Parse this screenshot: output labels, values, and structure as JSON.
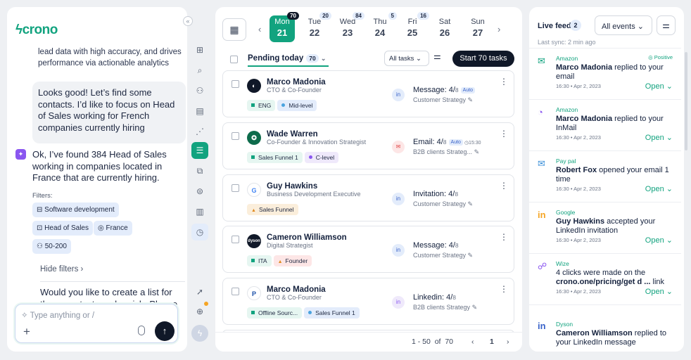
{
  "brand": "crono",
  "chat": {
    "prev_text": "lead data with high accuracy, and drives performance via actionable analytics",
    "user_msg": "Looks good! Let’s find some contacts. I’d like to focus on Head of Sales working for French companies currently hiring",
    "ai_msg": "Ok, I’ve found 384 Head of Sales working in companies located in France that are currently hiring.",
    "filters_label": "Filters:",
    "chips": [
      "Software development",
      "Head of Sales",
      "France",
      "50-200"
    ],
    "hide_filters": "Hide filters",
    "followup": "Would you like to create a list for these contacts and enrich. Please ad",
    "input_placeholder": "Type anything or /"
  },
  "calendar": {
    "days": [
      {
        "name": "Mon",
        "date": "21",
        "count": "70",
        "selected": true
      },
      {
        "name": "Tue",
        "date": "22",
        "count": "20"
      },
      {
        "name": "Wed",
        "date": "23",
        "count": "84"
      },
      {
        "name": "Thu",
        "date": "24",
        "count": "5"
      },
      {
        "name": "Fri",
        "date": "25",
        "count": "16"
      },
      {
        "name": "Sat",
        "date": "26",
        "count": ""
      },
      {
        "name": "Sun",
        "date": "27",
        "count": ""
      }
    ]
  },
  "tasks": {
    "pending_label": "Pending today",
    "pending_count": "70",
    "filter_label": "All tasks",
    "start_label": "Start 70 tasks",
    "items": [
      {
        "name": "Marco Madonia",
        "role": "CTO & Co-Founder",
        "tags": [
          "ENG",
          "Mid-level"
        ],
        "action": "Message: 4/",
        "total": "8",
        "auto": "Auto",
        "time": "",
        "sequence": "Customer Strategy"
      },
      {
        "name": "Wade Warren",
        "role": "Co-Founder & Innovation Strategist",
        "tags": [
          "Sales Funnel 1",
          "C-level"
        ],
        "action": "Email: 4/",
        "total": "8",
        "auto": "Auto",
        "time": "15:30",
        "sequence": "B2B clients Strateg..."
      },
      {
        "name": "Guy Hawkins",
        "role": "Business Development Executive",
        "tags": [
          "Sales Funnel"
        ],
        "action": "Invitation: 4/",
        "total": "8",
        "auto": "",
        "time": "",
        "sequence": "Customer Strategy"
      },
      {
        "name": "Cameron Williamson",
        "role": "Digital Strategist",
        "tags": [
          "ITA",
          "Founder"
        ],
        "action": "Message: 4/",
        "total": "8",
        "auto": "",
        "time": "",
        "sequence": "Customer Strategy"
      },
      {
        "name": "Marco Madonia",
        "role": "CTO & Co-Founder",
        "tags": [
          "Offline Sourc...",
          "Sales Funnel 1"
        ],
        "action": "Linkedin: 4/",
        "total": "8",
        "auto": "",
        "time": "",
        "sequence": "B2B clients Strategy"
      }
    ],
    "pagination": {
      "range": "1 - 50",
      "of": "of",
      "total": "70",
      "page": "1"
    }
  },
  "feed": {
    "title": "Live feed",
    "count": "2",
    "filter": "All events",
    "sync": "Last sync: 2 min ago",
    "items": [
      {
        "company": "Amazon",
        "badge": "Positive",
        "who": "Marco Madonia",
        "text": " replied to your email",
        "date": "16:30 • Apr 2, 2023",
        "open": "Open"
      },
      {
        "company": "Amazon",
        "badge": "",
        "who": "Marco Madonia",
        "text": " replied to your InMail",
        "date": "16:30 • Apr 2, 2023",
        "open": "Open"
      },
      {
        "company": "Pay pal",
        "badge": "",
        "who": "Robert Fox",
        "text": " opened your email 1 time",
        "date": "16:30 • Apr 2, 2023",
        "open": "Open"
      },
      {
        "company": "Google",
        "badge": "",
        "who": "Guy Hawkins",
        "text": " accepted your LinkedIn invitation",
        "date": "16:30 • Apr 2, 2023",
        "open": "Open"
      },
      {
        "company": "Wize",
        "badge": "",
        "who": "",
        "text": "4 clicks were made on the ",
        "link": "crono.one/pricing/get d ...",
        "tail": " link",
        "date": "16:30 • Apr 2, 2023",
        "open": "Open"
      },
      {
        "company": "Dyson",
        "badge": "",
        "who": "Cameron Williamson",
        "text": " replied to your LinkedIn message",
        "date": "",
        "open": ""
      }
    ]
  }
}
